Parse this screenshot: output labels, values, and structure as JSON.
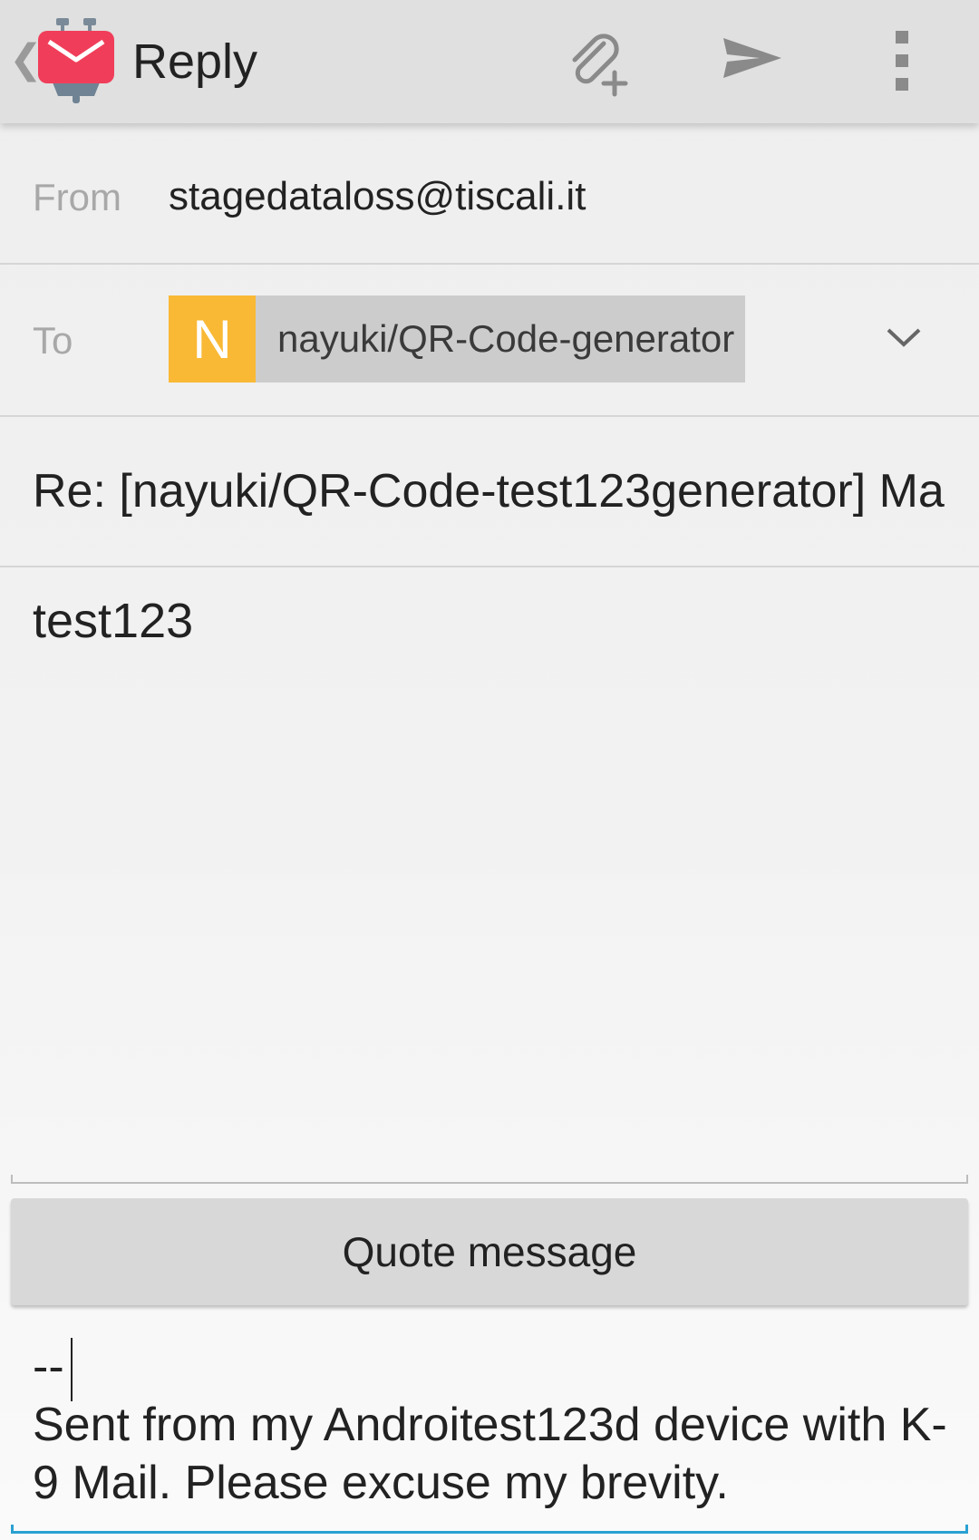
{
  "appbar": {
    "title": "Reply",
    "icons": [
      "back-chevron-icon",
      "k9-mail-logo",
      "attach-add-icon",
      "send-icon",
      "overflow-menu-icon"
    ]
  },
  "from": {
    "label": "From",
    "value": "stagedataloss@tiscali.it"
  },
  "to": {
    "label": "To",
    "recipient_initial": "N",
    "recipient_name": "nayuki/QR-Code-generator",
    "avatar_color": "#f9b935"
  },
  "subject": "Re: [nayuki/QR-Code-test123generator] Ma",
  "body": "test123",
  "quote_button_label": "Quote message",
  "signature": {
    "separator": "--",
    "text": "Sent from my Androitest123d device with K-9 Mail. Please excuse my brevity."
  },
  "colors": {
    "appbar": "#e0e0e0",
    "accent": "#2aa1d2",
    "logo": "#f03e5a"
  }
}
